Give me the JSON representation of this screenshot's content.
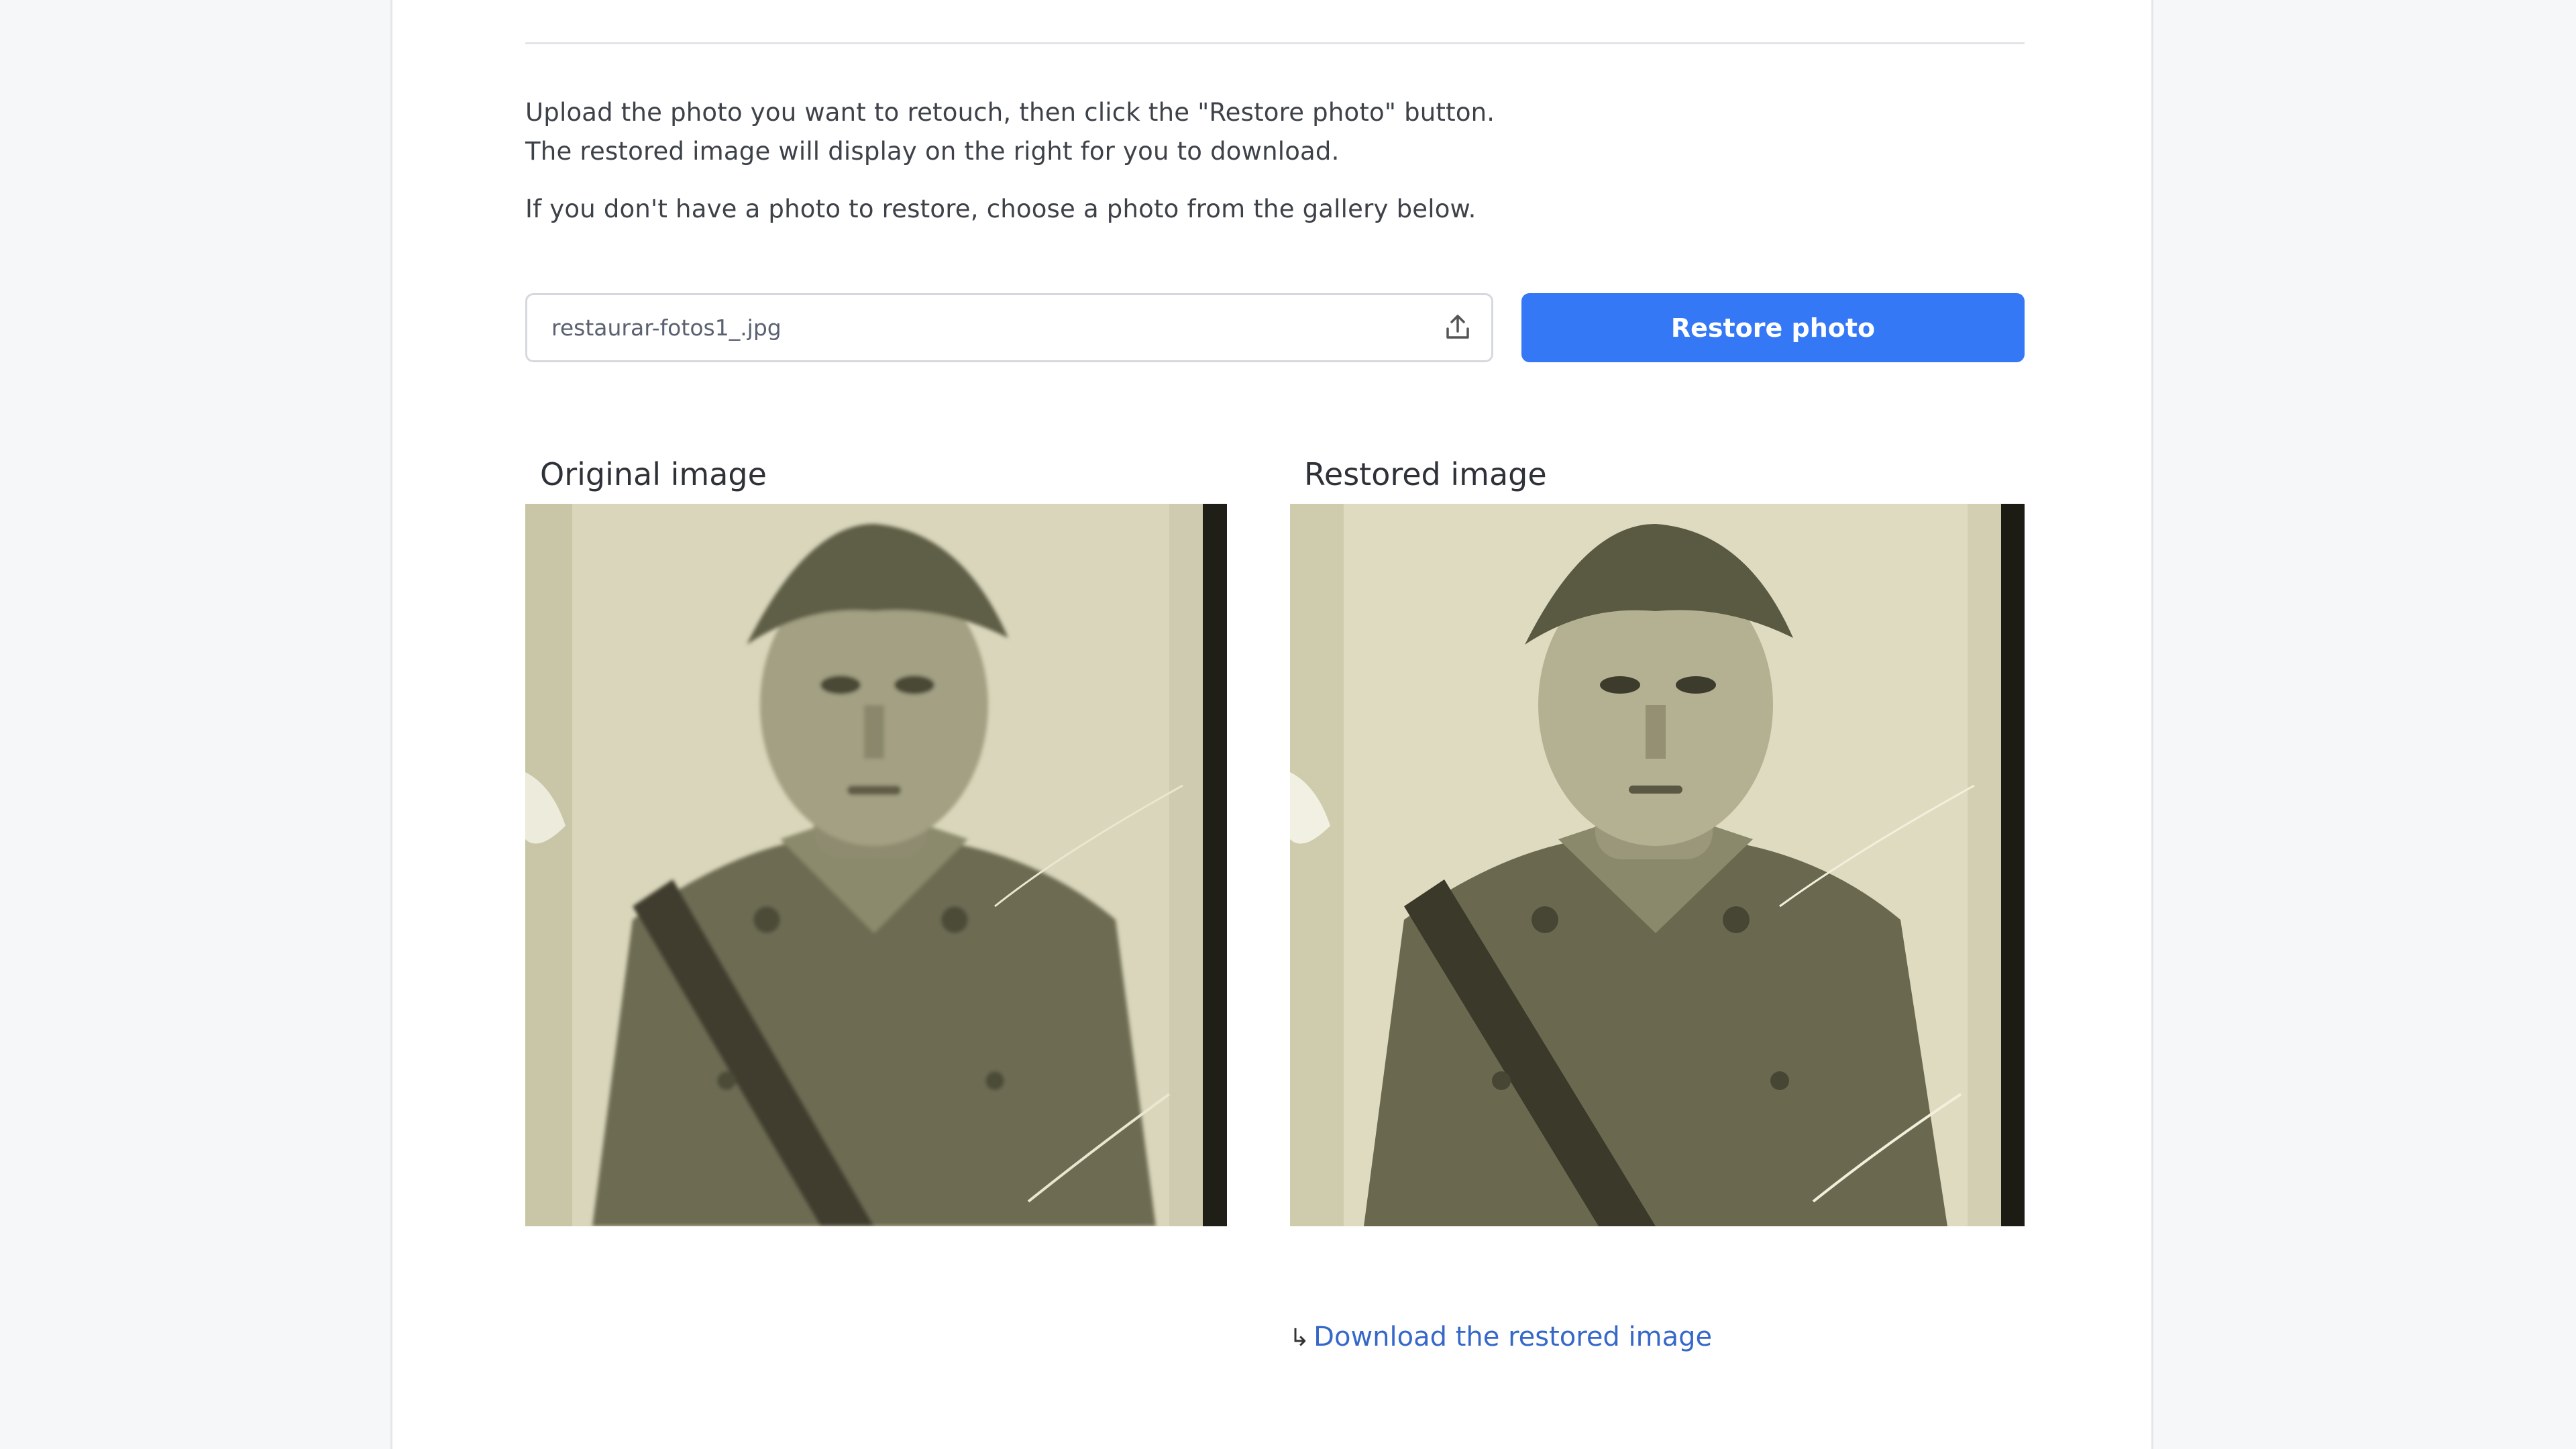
{
  "instructions": {
    "line1": "Upload the photo you want to retouch, then click the \"Restore photo\" button.",
    "line2": "The restored image will display on the right for you to download.",
    "line3": "If you don't have a photo to restore, choose a photo from the gallery below."
  },
  "upload": {
    "file_name": "restaurar-fotos1_.jpg",
    "icon": "upload-icon"
  },
  "restore_button": {
    "label": "Restore photo",
    "color": "#3478f6"
  },
  "original": {
    "label": "Original image"
  },
  "restored": {
    "label": "Restored image"
  },
  "download": {
    "icon": "download-arrow-icon",
    "arrow": "↳",
    "label": "Download the restored image",
    "color": "#3568c9"
  },
  "colors": {
    "background": "#f6f7f9",
    "card": "#ffffff",
    "photo_paper": "#d8d4b8",
    "photo_sepia": "#6f6e52"
  }
}
